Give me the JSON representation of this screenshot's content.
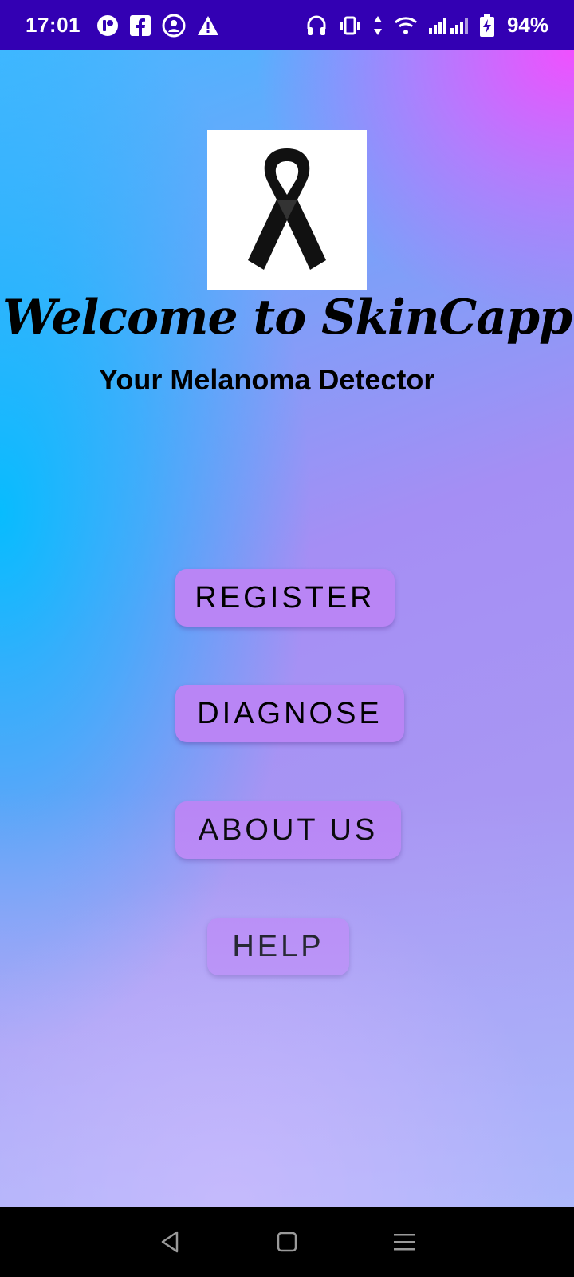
{
  "status_bar": {
    "time": "17:01",
    "battery": "94%",
    "notification_icons": [
      "app-notification-icon",
      "facebook-icon",
      "vpn-icon",
      "warning-icon"
    ],
    "system_icons": [
      "headphones-icon",
      "vibrate-icon",
      "data-arrows-icon",
      "wifi-icon",
      "signal-icon",
      "battery-charging-icon"
    ]
  },
  "main": {
    "logo": "black-ribbon-icon",
    "welcome": "Welcome to SkinCapp",
    "subtitle": "Your Melanoma Detector",
    "buttons": {
      "register": "REGISTER",
      "diagnose": "DIAGNOSE",
      "about": "ABOUT US",
      "help": "HELP"
    }
  },
  "nav_bar": {
    "icons": [
      "back-icon",
      "home-icon",
      "recents-icon"
    ]
  },
  "colors": {
    "status_bar": "#3300b3",
    "button": "#b985f5",
    "gradient_left": "#00beff",
    "gradient_top_right": "#f050ff"
  }
}
